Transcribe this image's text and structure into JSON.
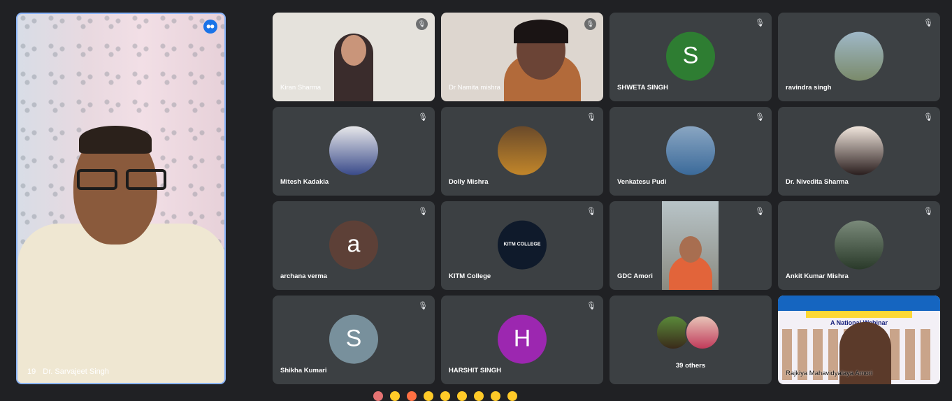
{
  "speaker": {
    "name": "Dr. Sarvajeet Singh",
    "badge": "19"
  },
  "tiles": [
    {
      "name": "Kiran Sharma",
      "kind": "video"
    },
    {
      "name": "Dr Namita mishra",
      "kind": "video"
    },
    {
      "name": "SHWETA SINGH",
      "kind": "letter",
      "letter": "S",
      "color": "#2e7d32"
    },
    {
      "name": "ravindra singh",
      "kind": "photo"
    },
    {
      "name": "Mitesh Kadakia",
      "kind": "photo"
    },
    {
      "name": "Dolly Mishra",
      "kind": "photo"
    },
    {
      "name": "Venkatesu Pudi",
      "kind": "photo"
    },
    {
      "name": "Dr. Nivedita Sharma",
      "kind": "photo"
    },
    {
      "name": "archana verma",
      "kind": "letter",
      "letter": "a",
      "color": "#5d4037"
    },
    {
      "name": "KITM College",
      "kind": "photo",
      "logo_text": "KITM COLLEGE"
    },
    {
      "name": "GDC Amori",
      "kind": "video"
    },
    {
      "name": "Ankit Kumar Mishra",
      "kind": "photo"
    },
    {
      "name": "Shikha Kumari",
      "kind": "letter",
      "letter": "S",
      "color": "#78909c"
    },
    {
      "name": "HARSHIT SINGH",
      "kind": "letter",
      "letter": "H",
      "color": "#9c27b0"
    },
    {
      "name": "39 others",
      "kind": "others"
    },
    {
      "name": "Rajkiya Mahavidyalaya Amori",
      "kind": "screen",
      "poster_title": "A National Webinar"
    }
  ],
  "icons": {
    "mute": "mic-off-icon",
    "speaking": "audio-level-icon"
  }
}
